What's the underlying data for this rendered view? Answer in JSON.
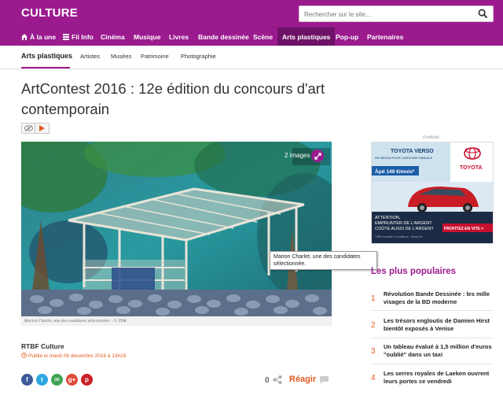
{
  "site": {
    "brand": "CULTURE"
  },
  "search": {
    "placeholder": "Rechercher sur le site..."
  },
  "nav": {
    "items": [
      {
        "label": "À la une",
        "icon": "home-icon"
      },
      {
        "label": "Fil Info",
        "icon": "list-icon"
      },
      {
        "label": "Cinéma"
      },
      {
        "label": "Musique"
      },
      {
        "label": "Livres"
      },
      {
        "label": "Bande dessinée"
      },
      {
        "label": "Scène"
      },
      {
        "label": "Arts plastiques",
        "active": true
      },
      {
        "label": "Pop-up"
      },
      {
        "label": "Partenaires"
      }
    ]
  },
  "subnav": {
    "current": "Arts plastiques",
    "items": [
      "Artistes",
      "Musées",
      "Patrimoine",
      "Photographie"
    ]
  },
  "article": {
    "title": "ArtContest 2016 : 12e édition du concours d'art contemporain",
    "image_count": "2 images",
    "tooltip": "Marion Charlet, une des candidates sélectionnée.",
    "caption": "Marion Charlet, une des candidates sélectionnée. - © TDR",
    "source": "RTBF Culture",
    "published": "Publié le mardi 06 décembre 2016 à 13h19"
  },
  "social": {
    "share_count": "0",
    "react_label": "Réagir",
    "buttons": [
      {
        "name": "facebook",
        "glyph": "f",
        "color": "#3b5998"
      },
      {
        "name": "twitter",
        "glyph": "t",
        "color": "#2da7e0"
      },
      {
        "name": "email",
        "glyph": "✉",
        "color": "#3ea654"
      },
      {
        "name": "google-plus",
        "glyph": "g+",
        "color": "#dd4b39"
      },
      {
        "name": "pinterest",
        "glyph": "p",
        "color": "#cb2027"
      }
    ]
  },
  "sidebar": {
    "ad_label": "Publicité",
    "ad": {
      "model": "TOYOTA VERSO",
      "tagline": "PAS BESOIN POUR L'AVENTURE FAMILIALE",
      "price": "Àpd 149 €/mois*",
      "brand": "TOYOTA",
      "slogan_line1": "ATTENTION,",
      "slogan_line2": "EMPRUNTER DE L'ARGENT",
      "slogan_line3": "COÛTE AUSSI DE L'ARGENT",
      "cta": "PROFITEZ-EN VITE >",
      "fine_print": "*Offre soumise à conditions - rfeuse-kh"
    },
    "popular_title": "Les plus populaires",
    "popular": [
      {
        "num": "1",
        "text": "Révolution Bande Dessinée : les mille visages de la BD moderne"
      },
      {
        "num": "2",
        "text": "Les trésors engloutis de Damien Hirst bientôt exposés à Venise"
      },
      {
        "num": "3",
        "text": "Un tableau évalué à 1,5 million d'euros \"oublié\" dans un taxi"
      },
      {
        "num": "4",
        "text": "Les serres royales de Laeken ouvrent leurs portes ce vendredi"
      }
    ]
  }
}
